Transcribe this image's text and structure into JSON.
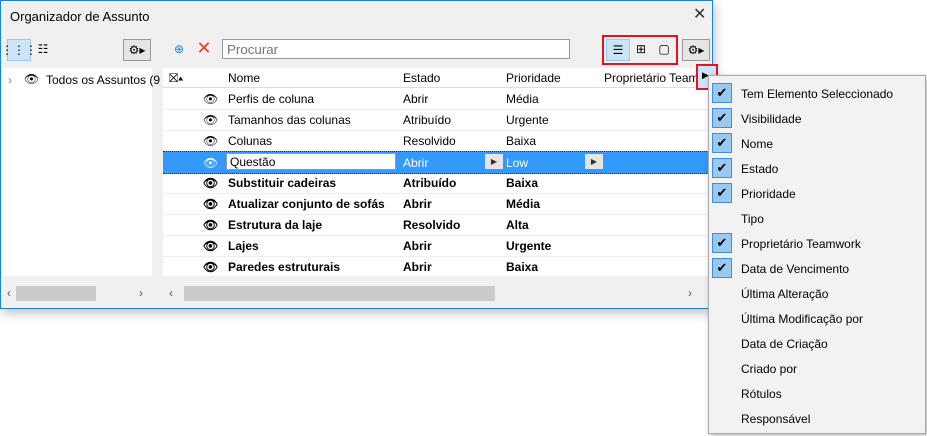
{
  "window": {
    "title": "Organizador de Assunto",
    "close": "✕"
  },
  "left": {
    "tree_item": "Todos os Assuntos (9"
  },
  "search": {
    "placeholder": "Procurar"
  },
  "columns": [
    "Nome",
    "Estado",
    "Prioridade",
    "Proprietário Teamw"
  ],
  "rows": [
    {
      "nome": "Perfis de coluna",
      "estado": "Abrir",
      "prioridade": "Média",
      "bold": false
    },
    {
      "nome": "Tamanhos das colunas",
      "estado": "Atribuído",
      "prioridade": "Urgente",
      "bold": false
    },
    {
      "nome": "Colunas",
      "estado": "Resolvido",
      "prioridade": "Baixa",
      "bold": false
    },
    {
      "nome": "Questão",
      "estado": "Abrir",
      "prioridade": "Low",
      "bold": false,
      "selected": true
    },
    {
      "nome": "Substituir cadeiras",
      "estado": "Atribuído",
      "prioridade": "Baixa",
      "bold": true
    },
    {
      "nome": "Atualizar conjunto de sofás",
      "estado": "Abrir",
      "prioridade": "Média",
      "bold": true
    },
    {
      "nome": "Estrutura da laje",
      "estado": "Resolvido",
      "prioridade": "Alta",
      "bold": true
    },
    {
      "nome": "Lajes",
      "estado": "Abrir",
      "prioridade": "Urgente",
      "bold": true
    },
    {
      "nome": "Paredes estruturais",
      "estado": "Abrir",
      "prioridade": "Baixa",
      "bold": true
    }
  ],
  "menu": [
    {
      "label": "Tem Elemento Seleccionado",
      "checked": true
    },
    {
      "label": "Visibilidade",
      "checked": true
    },
    {
      "label": "Nome",
      "checked": true
    },
    {
      "label": "Estado",
      "checked": true
    },
    {
      "label": "Prioridade",
      "checked": true
    },
    {
      "label": "Tipo",
      "checked": false
    },
    {
      "label": "Proprietário Teamwork",
      "checked": true
    },
    {
      "label": "Data de Vencimento",
      "checked": true
    },
    {
      "label": "Última Alteração",
      "checked": false
    },
    {
      "label": "Última Modificação por",
      "checked": false
    },
    {
      "label": "Data de Criação",
      "checked": false
    },
    {
      "label": "Criado por",
      "checked": false
    },
    {
      "label": "Rótulos",
      "checked": false
    },
    {
      "label": "Responsável",
      "checked": false
    }
  ]
}
